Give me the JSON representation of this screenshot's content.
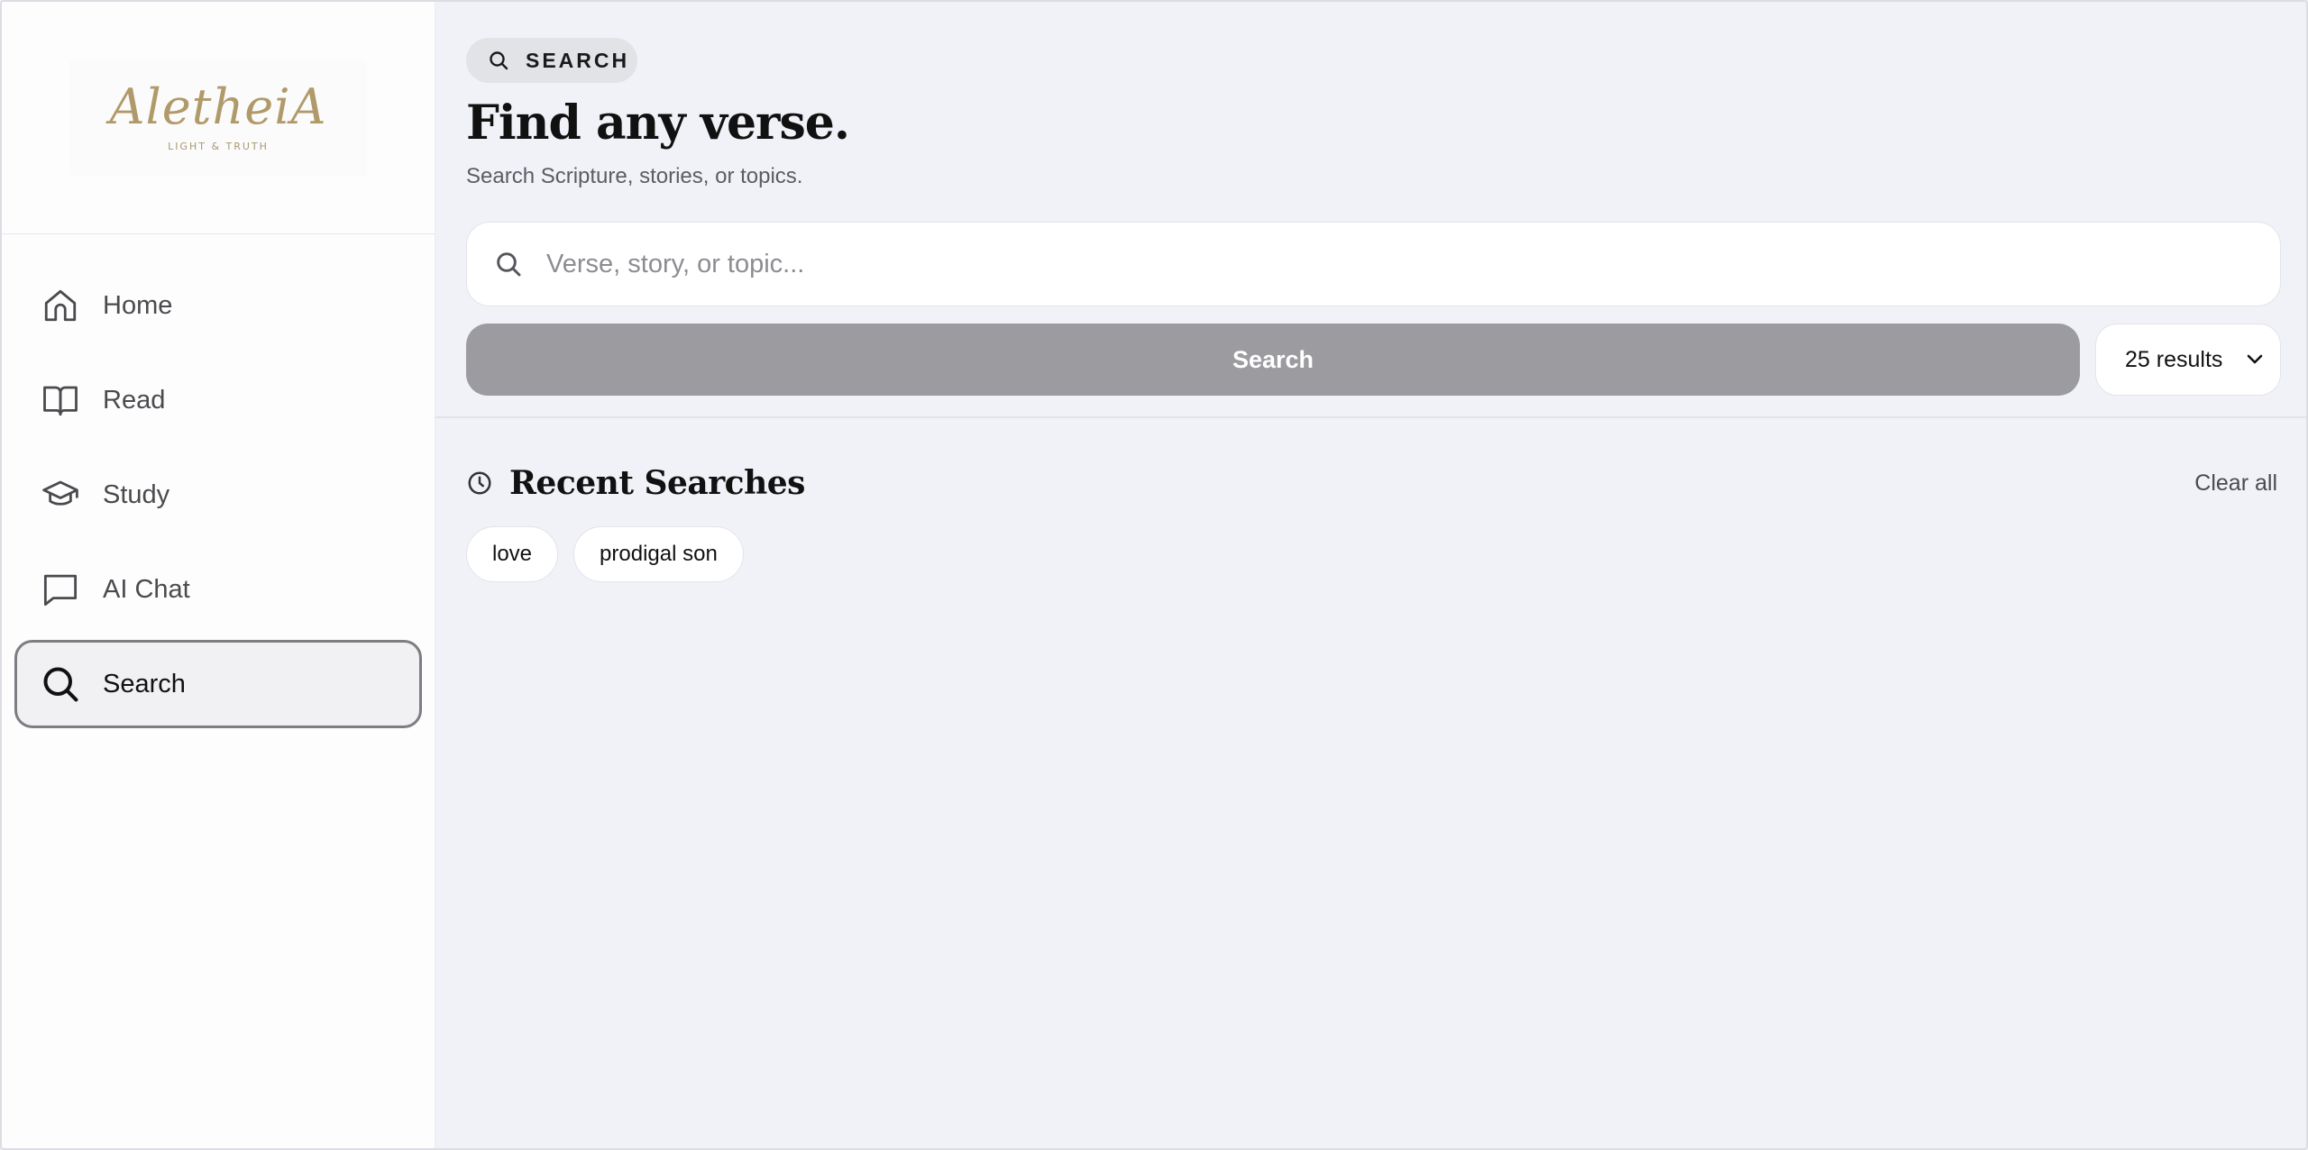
{
  "brand": {
    "logo_script": "AletheiA",
    "logo_tagline": "LIGHT & TRUTH"
  },
  "sidebar": {
    "items": [
      {
        "label": "Home",
        "icon": "home-icon"
      },
      {
        "label": "Read",
        "icon": "book-icon"
      },
      {
        "label": "Study",
        "icon": "graduation-cap-icon"
      },
      {
        "label": "AI Chat",
        "icon": "chat-bubble-icon"
      },
      {
        "label": "Search",
        "icon": "search-icon",
        "active": true
      }
    ]
  },
  "header": {
    "pill_label": "SEARCH",
    "title": "Find any verse.",
    "subtitle": "Search Scripture, stories, or topics."
  },
  "search": {
    "placeholder": "Verse, story, or topic...",
    "value": "",
    "button_label": "Search",
    "results_selected": "25 results"
  },
  "recent": {
    "title": "Recent Searches",
    "clear_label": "Clear all",
    "items": [
      "love",
      "prodigal son"
    ]
  },
  "colors": {
    "background": "#f1f2f7",
    "sidebar_bg": "#fdfdfd",
    "search_button": "#9b9ba0",
    "logo_gold": "#b09a6a"
  }
}
